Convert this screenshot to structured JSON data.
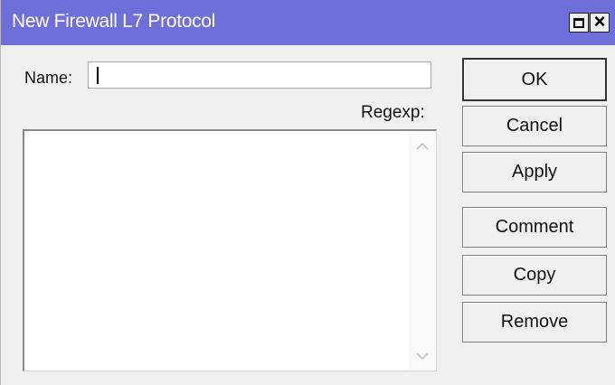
{
  "window": {
    "title": "New Firewall L7 Protocol"
  },
  "form": {
    "name_label": "Name:",
    "name_value": "",
    "regexp_label": "Regexp:",
    "regexp_value": ""
  },
  "buttons": {
    "ok": "OK",
    "cancel": "Cancel",
    "apply": "Apply",
    "comment": "Comment",
    "copy": "Copy",
    "remove": "Remove"
  },
  "icons": {
    "maximize": "maximize-icon",
    "close": "close-icon",
    "scroll_up": "chevron-up-icon",
    "scroll_down": "chevron-down-icon"
  },
  "colors": {
    "titlebar": "#6f6fd9",
    "window_bg": "#f0f0f0"
  }
}
